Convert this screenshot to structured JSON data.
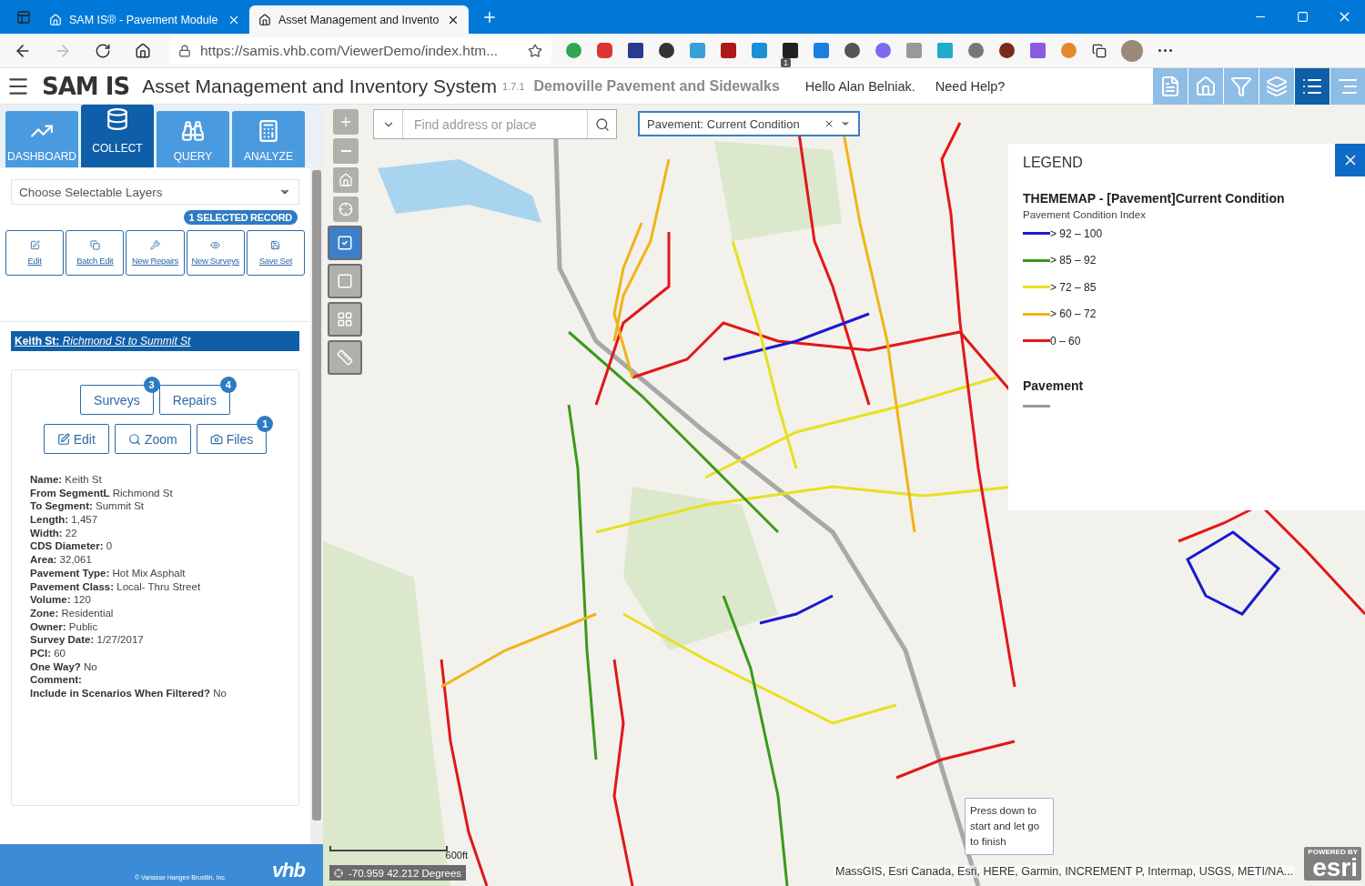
{
  "browser": {
    "tabs": [
      {
        "title": "SAM IS® - Pavement Module",
        "selected": false
      },
      {
        "title": "Asset Management and Invento",
        "selected": true
      }
    ],
    "url": "https://samis.vhb.com/ViewerDemo/index.htm...",
    "extension_badge": "1"
  },
  "header": {
    "logo": "SAM IS",
    "title": "Asset Management and Inventory System",
    "version": "1.7.1",
    "project": "Demoville Pavement and Sidewalks",
    "greeting": "Hello Alan Belniak.",
    "help": "Need Help?",
    "tools": [
      {
        "kind": "edit",
        "selected": false
      },
      {
        "kind": "home",
        "selected": false
      },
      {
        "kind": "filter",
        "selected": false
      },
      {
        "kind": "layers",
        "selected": false
      },
      {
        "kind": "list",
        "selected": true
      },
      {
        "kind": "menu",
        "selected": false
      }
    ]
  },
  "sidebar": {
    "tabs": [
      {
        "kind": "chart",
        "label": "DASHBOARD",
        "selected": false
      },
      {
        "kind": "database",
        "label": "COLLECT",
        "selected": true
      },
      {
        "kind": "binoculars",
        "label": "QUERY",
        "selected": false
      },
      {
        "kind": "calculator",
        "label": "ANALYZE",
        "selected": false
      }
    ],
    "layer_select": {
      "placeholder": "Choose Selectable Layers"
    },
    "selected_badge": "1 SELECTED RECORD",
    "actions": [
      {
        "kind": "edit",
        "label": "Edit"
      },
      {
        "kind": "copy",
        "label": "Batch Edit"
      },
      {
        "kind": "wrench",
        "label": "New Repairs"
      },
      {
        "kind": "eye",
        "label": "New Surveys"
      },
      {
        "kind": "save",
        "label": "Save Set"
      }
    ],
    "record": {
      "name": "Keith St:",
      "segment": "Richmond St to Summit St",
      "buttons": [
        {
          "label": "Surveys",
          "count": "3"
        },
        {
          "label": "Repairs",
          "count": "4"
        }
      ],
      "tools": [
        {
          "kind": "edit",
          "label": "Edit"
        },
        {
          "kind": "search",
          "label": "Zoom"
        },
        {
          "kind": "camera",
          "label": "Files",
          "count": "1"
        }
      ],
      "fields": [
        {
          "label": "Name:",
          "value": "Keith St"
        },
        {
          "label": "From SegmentL",
          "value": "Richmond St"
        },
        {
          "label": "To Segment:",
          "value": "Summit St"
        },
        {
          "label": "Length:",
          "value": "1,457"
        },
        {
          "label": "Width:",
          "value": "22"
        },
        {
          "label": "CDS Diameter:",
          "value": "0"
        },
        {
          "label": "Area:",
          "value": "32,061"
        },
        {
          "label": "Pavement Type:",
          "value": "Hot Mix Asphalt"
        },
        {
          "label": "Pavement Class:",
          "value": "Local- Thru Street"
        },
        {
          "label": "Volume:",
          "value": "120"
        },
        {
          "label": "Zone:",
          "value": "Residential"
        },
        {
          "label": "Owner:",
          "value": "Public"
        },
        {
          "label": "Survey Date:",
          "value": "1/27/2017"
        },
        {
          "label": "PCI:",
          "value": "60"
        },
        {
          "label": "One Way?",
          "value": "No"
        },
        {
          "label": "Comment:"
        },
        {
          "label": "Include in Scenarios When Filtered?",
          "value": "No"
        }
      ]
    },
    "footer": {
      "copyright": "© Vanasse Hangen Brustlin, Inc.",
      "logo": "vhb"
    }
  },
  "map": {
    "tools": [
      {
        "kind": "zoom-in",
        "selected": false
      },
      {
        "kind": "zoom-out",
        "selected": false
      },
      {
        "kind": "home",
        "selected": false
      },
      {
        "kind": "locate",
        "selected": false
      },
      {
        "kind": "checkbox",
        "selected": true
      },
      {
        "kind": "square",
        "selected": false
      },
      {
        "kind": "grid",
        "selected": false
      },
      {
        "kind": "ruler",
        "selected": false
      }
    ],
    "search": {
      "placeholder": "Find address or place"
    },
    "layer": {
      "value": "Pavement: Current Condition"
    },
    "legend": {
      "title": "LEGEND",
      "groups": [
        {
          "title": "THEMEMAP - [Pavement]Current Condition",
          "subtitle": "Pavement Condition Index",
          "items": [
            {
              "label": "> 92 – 100",
              "color": "#1a1acc"
            },
            {
              "label": "> 85 – 92",
              "color": "#3a9a1a"
            },
            {
              "label": "> 72 – 85",
              "color": "#e8e020"
            },
            {
              "label": "> 60 – 72",
              "color": "#f0b418"
            },
            {
              "label": "0 – 60",
              "color": "#e01818"
            }
          ]
        },
        {
          "title": "Pavement",
          "items": [
            {
              "color": "#9a9a9a"
            }
          ]
        }
      ]
    },
    "tooltip": "Press down to start and let go to finish",
    "scale": "600ft",
    "coordinates": "-70.959 42.212 Degrees",
    "attribution": "MassGIS, Esri Canada, Esri, HERE, Garmin, INCREMENT P, Intermap, USGS, METI/NA...",
    "powered_by": "POWERED BY",
    "esri_logo": "esri"
  }
}
